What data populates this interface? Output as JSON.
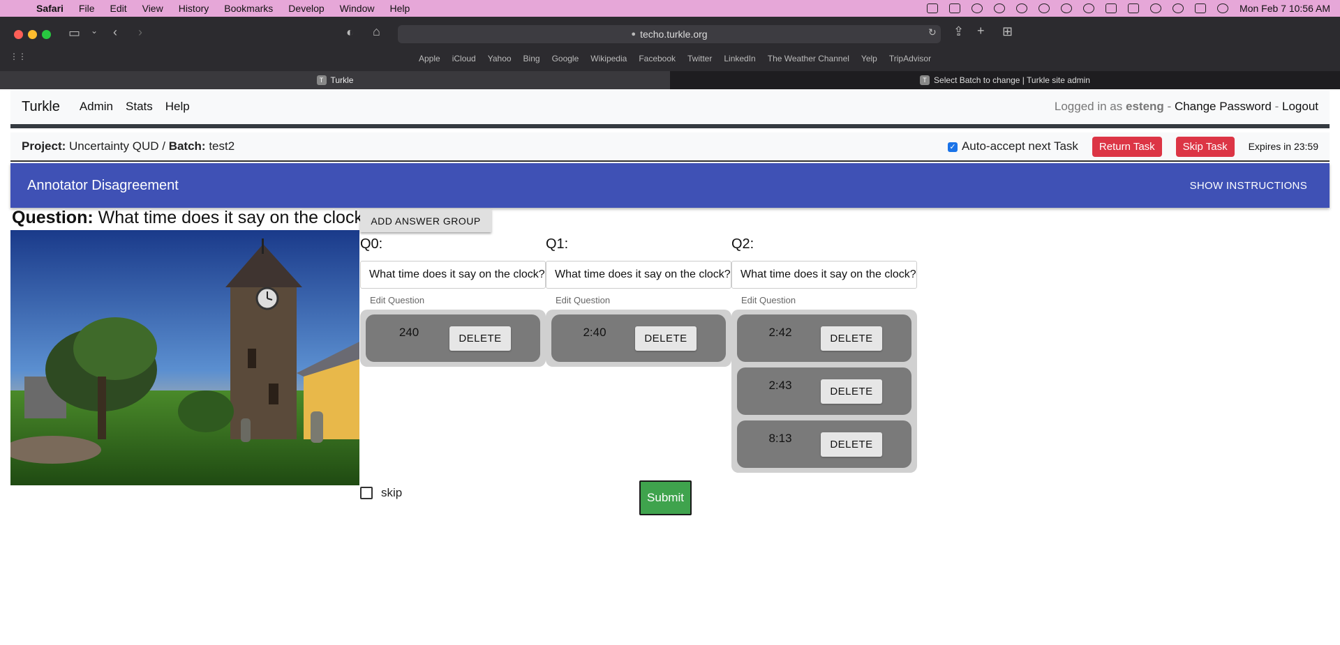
{
  "menubar": {
    "items": [
      "Safari",
      "File",
      "Edit",
      "View",
      "History",
      "Bookmarks",
      "Develop",
      "Window",
      "Help"
    ],
    "clock": "Mon Feb 7  10:56 AM"
  },
  "browser": {
    "url": "techo.turkle.org",
    "bookmarks": [
      "Apple",
      "iCloud",
      "Yahoo",
      "Bing",
      "Google",
      "Wikipedia",
      "Facebook",
      "Twitter",
      "LinkedIn",
      "The Weather Channel",
      "Yelp",
      "TripAdvisor"
    ],
    "tabs": [
      {
        "label": "Turkle",
        "favicon": "T"
      },
      {
        "label": "Select Batch to change | Turkle site admin",
        "favicon": "T"
      }
    ]
  },
  "nav": {
    "brand": "Turkle",
    "links": [
      "Admin",
      "Stats",
      "Help"
    ],
    "logged_prefix": "Logged in as",
    "user": "esteng",
    "change_password": "Change Password",
    "logout": "Logout",
    "sep": "-"
  },
  "project": {
    "project_label": "Project:",
    "project_name": "Uncertainty QUD",
    "batch_label": "Batch:",
    "batch_name": "test2",
    "auto_accept": "Auto-accept next Task",
    "return_task": "Return Task",
    "skip_task": "Skip Task",
    "expires": "Expires in 23:59"
  },
  "header": {
    "title": "Annotator Disagreement",
    "show_instructions": "SHOW INSTRUCTIONS"
  },
  "question": {
    "label": "Question:",
    "text": "What time does it say on the clock?"
  },
  "add_answer_group": "ADD ANSWER GROUP",
  "groups": [
    {
      "label": "Q0:",
      "input": "What time does it say on the clock?",
      "edit": "Edit Question",
      "answers": [
        "240"
      ]
    },
    {
      "label": "Q1:",
      "input": "What time does it say on the clock?",
      "edit": "Edit Question",
      "answers": [
        "2:40"
      ]
    },
    {
      "label": "Q2:",
      "input": "What time does it say on the clock?",
      "edit": "Edit Question",
      "answers": [
        "2:42",
        "2:43",
        "8:13"
      ]
    }
  ],
  "delete_label": "DELETE",
  "skip_label": "skip",
  "submit_label": "Submit",
  "colors": {
    "header": "#3f51b5",
    "danger": "#dc3545",
    "submit": "#3fa34d",
    "menubar": "#e6a7d8"
  }
}
